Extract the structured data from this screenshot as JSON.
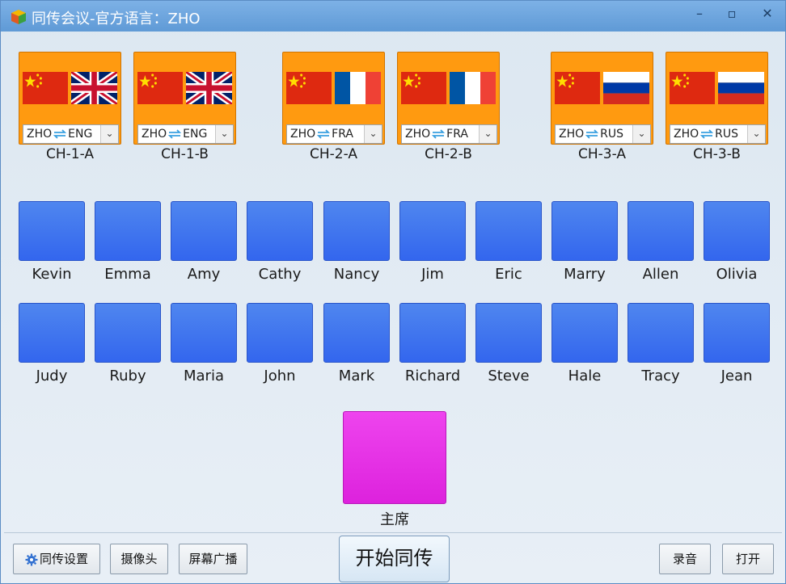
{
  "window": {
    "title": "同传会议-官方语言：ZHO",
    "controls": {
      "minimize": "–",
      "maximize": "▫",
      "close": "✕"
    }
  },
  "channels": [
    {
      "flag_right": "uk",
      "select_from": "ZHO",
      "select_to": "ENG",
      "label": "CH-1-A"
    },
    {
      "flag_right": "uk",
      "select_from": "ZHO",
      "select_to": "ENG",
      "label": "CH-1-B"
    },
    {
      "flag_right": "fr",
      "select_from": "ZHO",
      "select_to": "FRA",
      "label": "CH-2-A"
    },
    {
      "flag_right": "fr",
      "select_from": "ZHO",
      "select_to": "FRA",
      "label": "CH-2-B"
    },
    {
      "flag_right": "ru",
      "select_from": "ZHO",
      "select_to": "RUS",
      "label": "CH-3-A"
    },
    {
      "flag_right": "ru",
      "select_from": "ZHO",
      "select_to": "RUS",
      "label": "CH-3-B"
    }
  ],
  "seats_row1": [
    "Kevin",
    "Emma",
    "Amy",
    "Cathy",
    "Nancy",
    "Jim",
    "Eric",
    "Marry",
    "Allen",
    "Olivia"
  ],
  "seats_row2": [
    "Judy",
    "Ruby",
    "Maria",
    "John",
    "Mark",
    "Richard",
    "Steve",
    "Hale",
    "Tracy",
    "Jean"
  ],
  "chair": {
    "label": "主席"
  },
  "toolbar": {
    "settings_label": "同传设置",
    "camera_label": "摄像头",
    "broadcast_label": "屏幕广播",
    "start_label": "开始同传",
    "record_label": "录音",
    "open_label": "打开"
  },
  "colors": {
    "channel_bg": "#ff9a10",
    "seat_bg": "#3d73ef",
    "chair_bg": "#e633e6",
    "titlebar": "#6aa4de",
    "swap_arrow": "#3aa0e0"
  }
}
